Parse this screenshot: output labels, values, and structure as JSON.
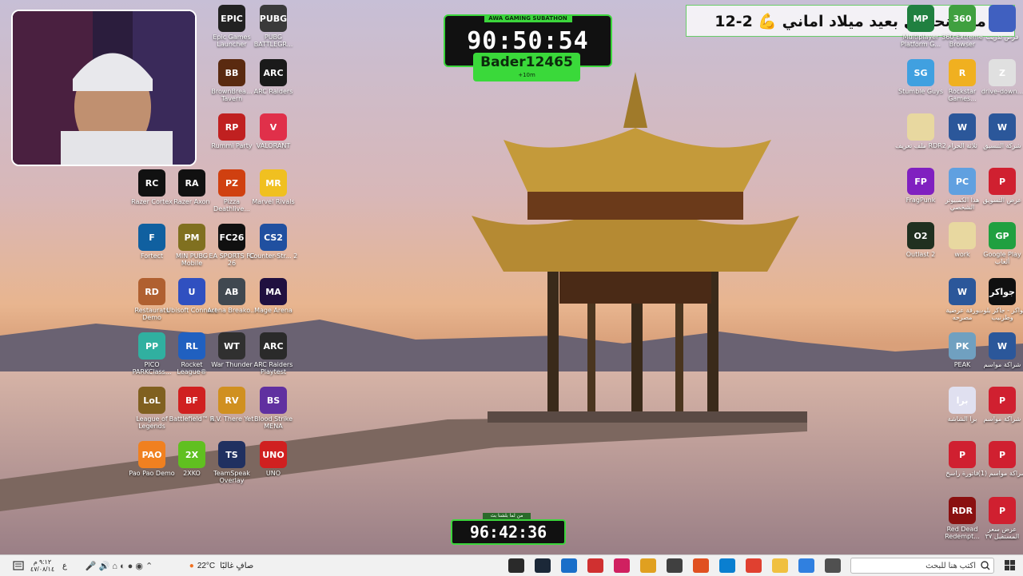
{
  "overlay": {
    "banner_text": "معاً لنحتفل بعيد ميلاد اماني 💪 2-12",
    "subathon_title": "AWA GAMING SUBATHON",
    "subathon_timer": "90:50:54",
    "donor_name": "Bader12465",
    "donor_sub": "+10m",
    "bottom_caption": "من لما بلشنا بث",
    "bottom_timer": "96:42:36"
  },
  "desktop_icons": [
    {
      "label": "Epic Games Launcher",
      "glyph": "EPIC",
      "color": "#222222"
    },
    {
      "label": "PUBG BATTLEGR...",
      "glyph": "PUBG",
      "color": "#3a3a3a"
    },
    {
      "label": "BrownBrea... Tavern",
      "glyph": "BB",
      "color": "#5a2a10"
    },
    {
      "label": "ARC Raiders",
      "glyph": "ARC",
      "color": "#1a1a1a"
    },
    {
      "label": "Rummi Party",
      "glyph": "RP",
      "color": "#c02020"
    },
    {
      "label": "VALORANT",
      "glyph": "V",
      "color": "#e0304a"
    },
    {
      "label": "Razer Cortex",
      "glyph": "RC",
      "color": "#111111"
    },
    {
      "label": "Razer Axon",
      "glyph": "RA",
      "color": "#111111"
    },
    {
      "label": "Pizza Deathlive...",
      "glyph": "PZ",
      "color": "#d04010"
    },
    {
      "label": "Marvel Rivals",
      "glyph": "MR",
      "color": "#f0c020"
    },
    {
      "label": "Fortect",
      "glyph": "F",
      "color": "#1060a0"
    },
    {
      "label": "MIN PUBG Mobile",
      "glyph": "PM",
      "color": "#807020"
    },
    {
      "label": "EA SPORTS FC 26",
      "glyph": "FC26",
      "color": "#101010"
    },
    {
      "label": "Counter-Str... 2",
      "glyph": "CS2",
      "color": "#2050a0"
    },
    {
      "label": "Restaurats Demo",
      "glyph": "RD",
      "color": "#b06030"
    },
    {
      "label": "Ubisoft Connect",
      "glyph": "U",
      "color": "#3050c0"
    },
    {
      "label": "Arena Breako...",
      "glyph": "AB",
      "color": "#404850"
    },
    {
      "label": "Mage Arena",
      "glyph": "MA",
      "color": "#201040"
    },
    {
      "label": "PICO PARKClass...",
      "glyph": "PP",
      "color": "#30b0a0"
    },
    {
      "label": "Rocket League®",
      "glyph": "RL",
      "color": "#2060c0"
    },
    {
      "label": "War Thunder",
      "glyph": "WT",
      "color": "#303030"
    },
    {
      "label": "ARC Raiders Playtest",
      "glyph": "ARC",
      "color": "#2a2a2a"
    },
    {
      "label": "League of Legends",
      "glyph": "LoL",
      "color": "#806020"
    },
    {
      "label": "Battlefield™ 6",
      "glyph": "BF",
      "color": "#d02020"
    },
    {
      "label": "R.V. There Yet",
      "glyph": "RV",
      "color": "#d09020"
    },
    {
      "label": "Blood Strike MENA",
      "glyph": "BS",
      "color": "#6030a0"
    },
    {
      "label": "Pao Pao Demo",
      "glyph": "PAO",
      "color": "#f08020"
    },
    {
      "label": "2XKO",
      "glyph": "2X",
      "color": "#60c020"
    },
    {
      "label": "TeamSpeak Overlay",
      "glyph": "TS",
      "color": "#203060"
    },
    {
      "label": "UNO",
      "glyph": "UNO",
      "color": "#d02020"
    },
    {
      "label": "Multiplayer Platform G...",
      "glyph": "MP",
      "color": "#208040"
    },
    {
      "label": "360 Extreme Browser",
      "glyph": "360",
      "color": "#40a040"
    },
    {
      "label": "فرص تدريب",
      "glyph": "",
      "color": "#4060c0"
    },
    {
      "label": "Stumble Guys",
      "glyph": "SG",
      "color": "#40a0e0"
    },
    {
      "label": "Rockstar Games...",
      "glyph": "R",
      "color": "#f0b020"
    },
    {
      "label": "drive-down...",
      "glyph": "Z",
      "color": "#e0e0e0"
    },
    {
      "label": "ملف تعريف RDR2",
      "glyph": "",
      "color": "#e8d8a0"
    },
    {
      "label": "ثلاثة الحرام",
      "glyph": "W",
      "color": "#2b579a"
    },
    {
      "label": "شركة التنسيق",
      "glyph": "W",
      "color": "#2b579a"
    },
    {
      "label": "FragPunk",
      "glyph": "FP",
      "color": "#8020c0"
    },
    {
      "label": "هذا الكمبيوتر الشخصي",
      "glyph": "PC",
      "color": "#60a0e0"
    },
    {
      "label": "عرض التسويق",
      "glyph": "P",
      "color": "#d02030"
    },
    {
      "label": "Outlast 2",
      "glyph": "O2",
      "color": "#203020"
    },
    {
      "label": "work",
      "glyph": "",
      "color": "#e8d8a0"
    },
    {
      "label": "Google Play ألعاب",
      "glyph": "GP",
      "color": "#20a040"
    },
    {
      "label": "ورقة عرضية مصرحه",
      "glyph": "W",
      "color": "#2b579a"
    },
    {
      "label": "جواكر - جاكر بلوت وطرنيب",
      "glyph": "جواكر",
      "color": "#101010"
    },
    {
      "label": "PEAK",
      "glyph": "PK",
      "color": "#70a0c0"
    },
    {
      "label": "شراكة مواسم",
      "glyph": "W",
      "color": "#2b579a"
    },
    {
      "label": "برا الشاشة",
      "glyph": "برا",
      "color": "#e0e0f0"
    },
    {
      "label": "شراكة مواسم",
      "glyph": "P",
      "color": "#d02030"
    },
    {
      "label": "فاتورة راسخ",
      "glyph": "P",
      "color": "#d02030"
    },
    {
      "label": "شراكة مواسم (1)",
      "glyph": "P",
      "color": "#d02030"
    },
    {
      "label": "Red Dead Redempt...",
      "glyph": "RDR",
      "color": "#8a1010"
    },
    {
      "label": "عرض سعر المستقبل ٣٧",
      "glyph": "P",
      "color": "#d02030"
    }
  ],
  "taskbar": {
    "search_placeholder": "اكتب هنا للبحث",
    "weather_temp": "22°C",
    "weather_desc": "صافٍ غالبًا",
    "time": "٩:١٢ م",
    "date": "٤٧/٠٨/١٤",
    "lang": "ع",
    "apps": [
      "terminal",
      "steam",
      "app",
      "red-app",
      "winrar",
      "explorer",
      "obs",
      "msn",
      "edge",
      "chrome",
      "folder",
      "photos",
      "store"
    ]
  }
}
